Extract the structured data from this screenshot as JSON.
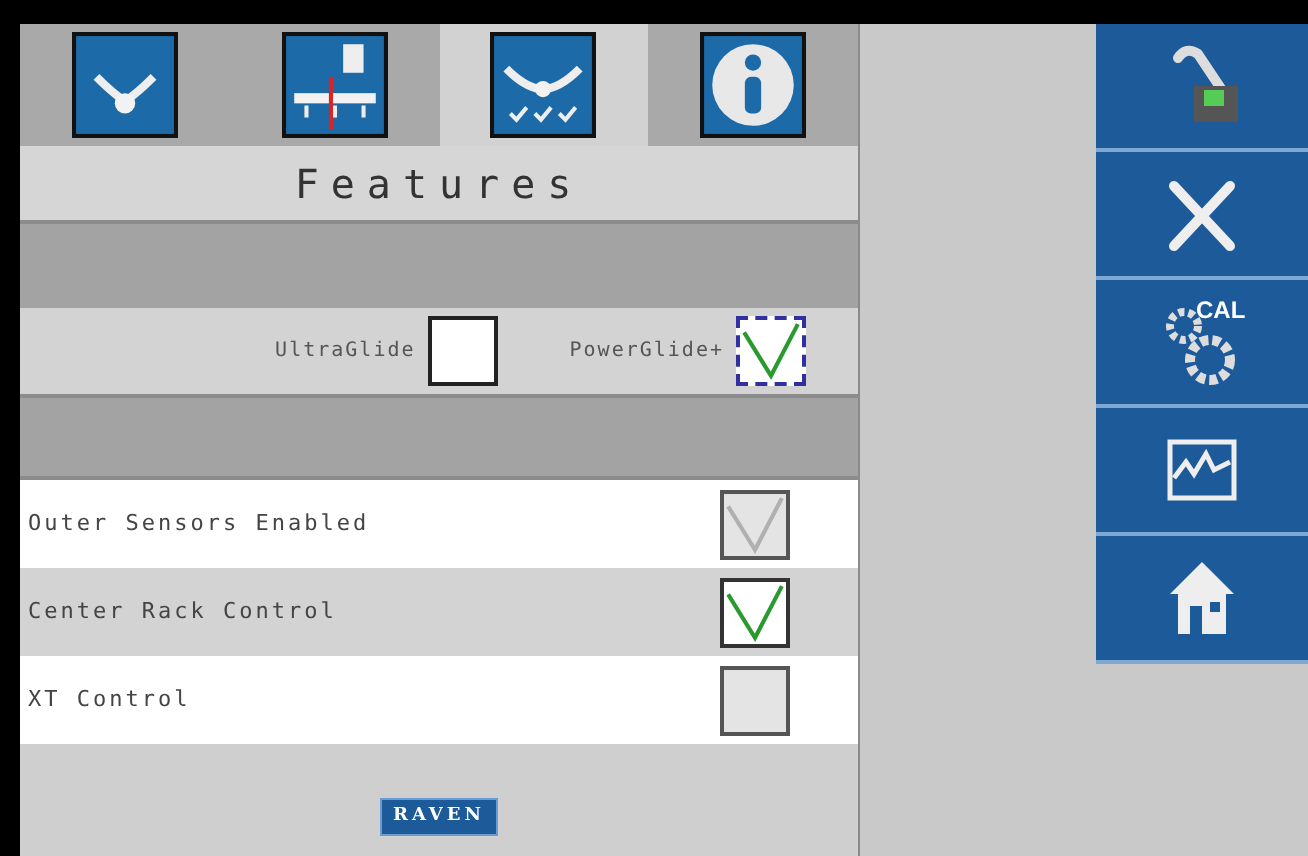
{
  "tabs": [
    {
      "kind": "sensors",
      "selected": false
    },
    {
      "kind": "boom",
      "selected": false
    },
    {
      "kind": "features",
      "selected": true
    },
    {
      "kind": "info",
      "selected": false
    }
  ],
  "title": "Features",
  "options": [
    {
      "label": "UltraGlide",
      "checked": false,
      "focused": false
    },
    {
      "label": "PowerGlide+",
      "checked": true,
      "focused": true
    }
  ],
  "settings": [
    {
      "label": "Outer Sensors Enabled",
      "checked": true,
      "disabled": true
    },
    {
      "label": "Center Rack Control",
      "checked": true,
      "disabled": false
    },
    {
      "label": "XT Control",
      "checked": false,
      "disabled": true
    }
  ],
  "logo": "RAVEN",
  "sidebar": [
    {
      "kind": "switch"
    },
    {
      "kind": "tools"
    },
    {
      "kind": "calibration",
      "label": "CAL"
    },
    {
      "kind": "chart"
    },
    {
      "kind": "home"
    }
  ]
}
